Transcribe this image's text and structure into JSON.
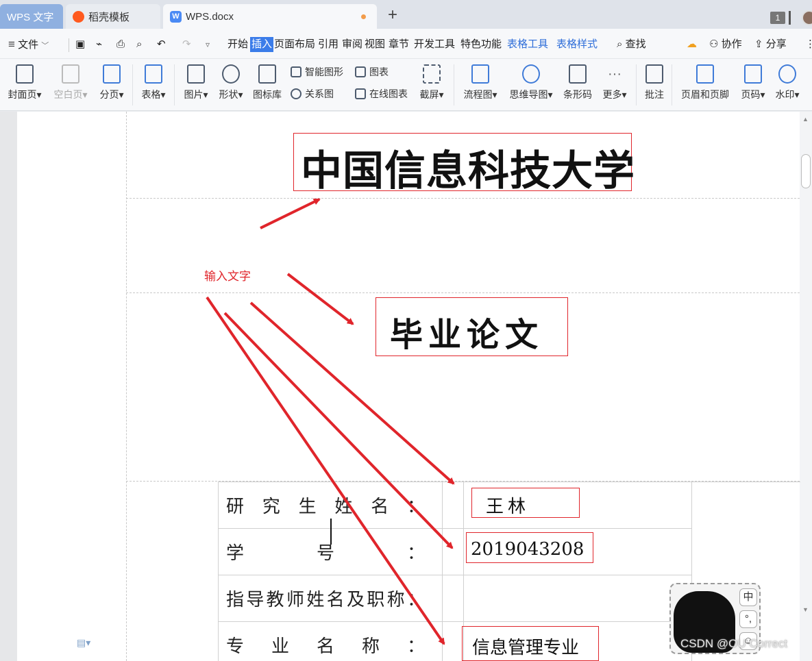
{
  "tabs": {
    "app": "WPS 文字",
    "template": "稻壳模板",
    "doc": "WPS.docx",
    "add": "+",
    "badge": "1"
  },
  "menu": {
    "hamburger": "≡",
    "file": "文件",
    "items": [
      "开始",
      "插入",
      "页面布局",
      "引用",
      "审阅",
      "视图",
      "章节",
      "开发工具",
      "特色功能"
    ],
    "context": [
      "表格工具",
      "表格样式"
    ],
    "search": "查找",
    "collab": "协作",
    "share": "分享"
  },
  "ribbon": {
    "cover": "封面页",
    "blank": "空白页",
    "pagebreak": "分页",
    "table": "表格",
    "picture": "图片",
    "shape": "形状",
    "iconlib": "图标库",
    "smartart": "智能图形",
    "chart": "图表",
    "relation": "关系图",
    "onlinechart": "在线图表",
    "screenshot": "截屏",
    "flowchart": "流程图",
    "mindmap": "思维导图",
    "barcode": "条形码",
    "more": "更多",
    "comment": "批注",
    "headerfooter": "页眉和页脚",
    "pagenum": "页码",
    "watermark": "水印"
  },
  "document": {
    "university": "中国信息科技大学",
    "thesis": "毕业论文",
    "annotation": "输入文字",
    "form": [
      {
        "label": "研究生姓名：",
        "value": "王林"
      },
      {
        "label": "学号：",
        "value": "2019043208"
      },
      {
        "label": "指导教师姓名及职称：",
        "value": ""
      },
      {
        "label": "专业名称：",
        "value": "信息管理专业"
      }
    ]
  },
  "ime": {
    "lang": "中",
    "punct": "°,",
    "skin": "☺"
  },
  "overlay": {
    "watermark": "CSDN @OU Correct"
  },
  "colors": {
    "accent": "#3b7ce9",
    "annotation": "#e0252b",
    "context_tab": "#2f6ed9"
  }
}
